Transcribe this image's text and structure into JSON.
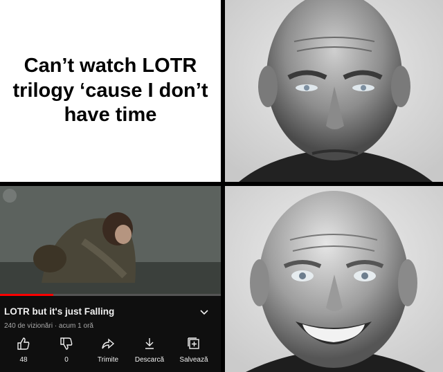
{
  "meme": {
    "top_left_text": "Can’t watch LOTR trilogy ‘cause I don’t have time"
  },
  "youtube": {
    "video_title": "LOTR but it's just Falling",
    "meta": "240 de vizionări · acum 1 oră",
    "progress": 0.24,
    "actions": {
      "like": "48",
      "dislike": "0",
      "share": "Trimite",
      "download": "Descarcă",
      "save": "Salvează"
    }
  },
  "colors": {
    "accent_red": "#ff0000",
    "yt_background": "#0f0f0f"
  }
}
